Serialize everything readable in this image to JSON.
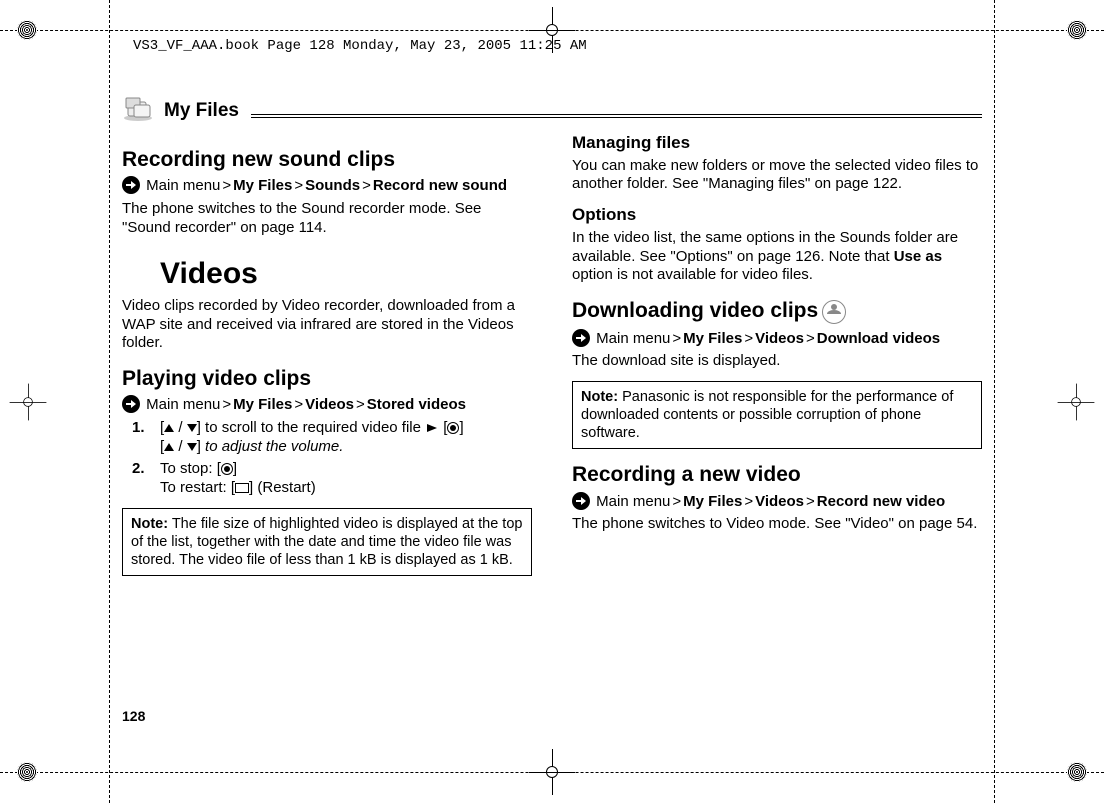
{
  "header_line": "VS3_VF_AAA.book  Page 128  Monday, May 23, 2005  11:25 AM",
  "section_title": "My Files",
  "page_number": "128",
  "col1": {
    "h_record": "Recording new sound clips",
    "path_record_parts": [
      "Main menu",
      "My Files",
      "Sounds",
      "Record new sound"
    ],
    "p_record": "The phone switches to the Sound recorder mode. See \"Sound recorder\" on page 114.",
    "h_videos": "Videos",
    "p_videos": "Video clips recorded by Video recorder, downloaded from a WAP site and received via infrared are stored in the Videos folder.",
    "h_play": "Playing video clips",
    "path_play_parts": [
      "Main menu",
      "My Files",
      "Videos",
      "Stored videos"
    ],
    "steps": {
      "s1": {
        "num": "1.",
        "a": "] to scroll to the required video file ",
        "b_italic_suffix": " to adjust the volume."
      },
      "s2": {
        "num": "2.",
        "a": "To stop: [",
        "b": "To restart: [",
        "b_suffix": "] (Restart)"
      }
    },
    "note": {
      "label": "Note:",
      "text": " The file size of highlighted video is displayed at the top of the list, together with the date and time the video file was stored. The video file of less than 1 kB is displayed as 1 kB."
    }
  },
  "col2": {
    "h_manage": "Managing files",
    "p_manage": "You can make new folders or move the selected video files to another folder. See \"Managing files\" on page 122.",
    "h_options": "Options",
    "p_options_a": "In the video list, the same options in the Sounds folder are available. See \"Options\" on page 126. Note that ",
    "p_options_bold": "Use as",
    "p_options_b": " option is not available for video files.",
    "h_download": "Downloading video clips",
    "path_download_parts": [
      "Main menu",
      "My Files",
      "Videos",
      "Download videos"
    ],
    "p_download": "The download site is displayed.",
    "note": {
      "label": "Note:",
      "text": " Panasonic is not responsible for the performance of downloaded contents or possible corruption of phone software."
    },
    "h_recordvideo": "Recording a new video",
    "path_recordvideo_parts": [
      "Main menu",
      "My Files",
      "Videos",
      "Record new video"
    ],
    "p_recordvideo": "The phone switches to Video mode. See \"Video\" on page 54."
  }
}
